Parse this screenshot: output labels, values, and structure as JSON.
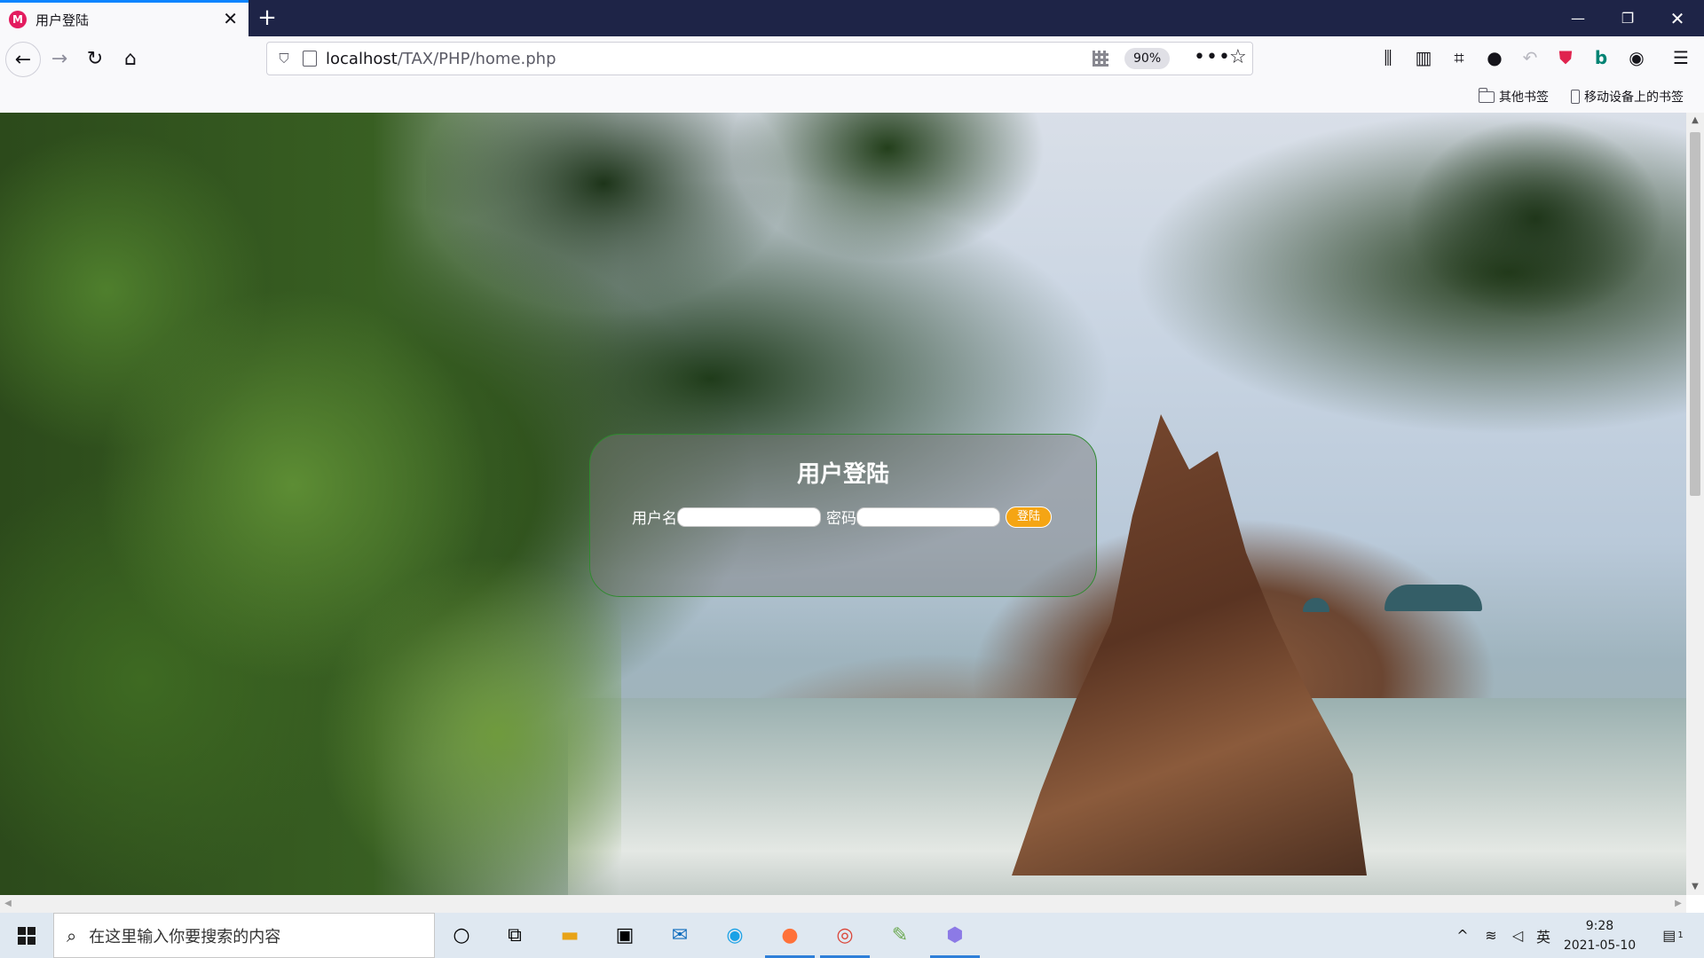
{
  "browser": {
    "tab_title": "用户登陆",
    "tab_favicon_letter": "M",
    "url_host": "localhost",
    "url_path": "/TAX/PHP/home.php",
    "zoom": "90%",
    "bookmarks": [
      "其他书签",
      "移动设备上的书签"
    ]
  },
  "page": {
    "login_title": "用户登陆",
    "username_label": "用户名",
    "username_value": "",
    "password_label": "密码",
    "password_value": "",
    "login_button": "登陆"
  },
  "taskbar": {
    "search_placeholder": "在这里输入你要搜索的内容",
    "ime_indicator": "英",
    "time": "9:28",
    "date": "2021-05-10",
    "notification_count": "1"
  },
  "colors": {
    "tabstrip": "#1e2447",
    "accent": "#0a84ff",
    "login_button": "#f5a514",
    "card_border": "#2f8a2f"
  },
  "icons": [
    "back-icon",
    "forward-icon",
    "reload-icon",
    "home-icon",
    "shield-icon",
    "page-icon",
    "qr-code-icon",
    "more-icon",
    "star-icon",
    "library-icon",
    "sidebar-icon",
    "screenshot-icon",
    "chat-icon",
    "undo-icon",
    "pocket-icon",
    "bing-icon",
    "account-icon",
    "menu-icon"
  ]
}
